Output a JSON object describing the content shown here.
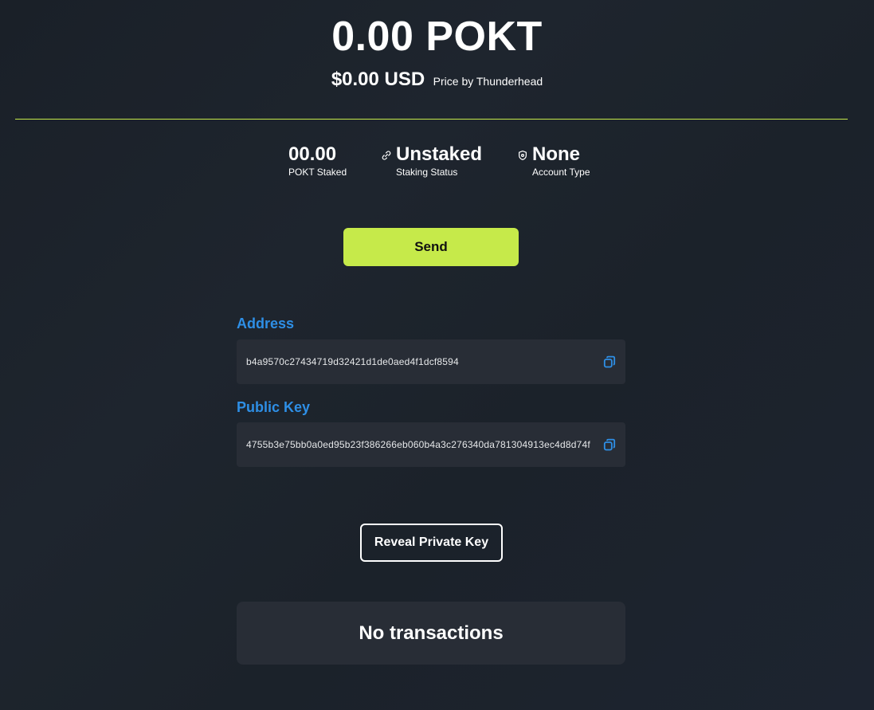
{
  "balance": {
    "amount": "0.00 POKT"
  },
  "fiat": {
    "usd": "$0.00 USD",
    "source": "Price by Thunderhead"
  },
  "colors": {
    "accent": "#c6ea4a",
    "link_blue": "#2e8fe6",
    "panel": "#282d36"
  },
  "stats": {
    "staked": {
      "value": "00.00",
      "label": "POKT Staked"
    },
    "status": {
      "value": "Unstaked",
      "label": "Staking Status",
      "icon": "link-icon"
    },
    "account": {
      "value": "None",
      "label": "Account Type",
      "icon": "shield-icon"
    }
  },
  "actions": {
    "send_label": "Send",
    "reveal_label": "Reveal Private Key"
  },
  "address": {
    "label": "Address",
    "value": "b4a9570c27434719d32421d1de0aed4f1dcf8594",
    "copy_icon": "copy-icon"
  },
  "public_key": {
    "label": "Public Key",
    "value": "4755b3e75bb0a0ed95b23f386266eb060b4a3c276340da781304913ec4d8d74f",
    "copy_icon": "copy-icon"
  },
  "transactions": {
    "empty_text": "No transactions"
  }
}
